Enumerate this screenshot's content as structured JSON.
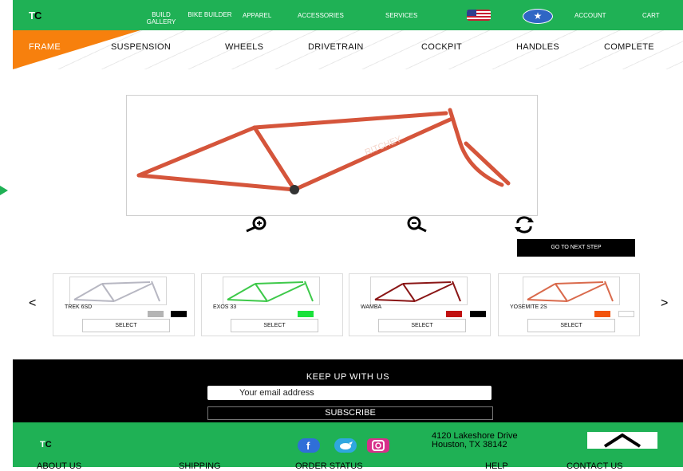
{
  "brand": {
    "logo_t": "T",
    "logo_c": "C"
  },
  "nav": {
    "build_gallery": "BUILD GALLERY",
    "bike_builder": "BIKE BUILDER",
    "apparel": "APPAREL",
    "accessories": "ACCESSORIES",
    "services": "SERVICES",
    "account": "ACCOUNT",
    "cart": "CART"
  },
  "steps": [
    "FRAME",
    "SUSPENSION",
    "WHEELS",
    "DRIVETRAIN",
    "COCKPIT",
    "HANDLES",
    "COMPLETE"
  ],
  "viewer": {
    "frame_text": "RITCHEY",
    "tools": [
      "zoom-in-icon",
      "zoom-out-icon",
      "rotate-icon"
    ]
  },
  "next_step": "GO TO NEXT STEP",
  "carousel": {
    "prev": "<",
    "next": ">",
    "items": [
      {
        "name": "TREK 6SD",
        "frame_color": "#b7b7c2",
        "swatches": [
          "#b4b4b4",
          "#000000"
        ],
        "select": "SELECT"
      },
      {
        "name": "EXOS 33",
        "frame_color": "#3ec94a",
        "swatches": [
          "#19e13a"
        ],
        "select": "SELECT"
      },
      {
        "name": "WAMBA",
        "frame_color": "#8a1616",
        "swatches": [
          "#c01010",
          "#000000"
        ],
        "select": "SELECT"
      },
      {
        "name": "YOSEMITE 2S",
        "frame_color": "#d96a4c",
        "swatches": [
          "#f2530b",
          "#ffffff"
        ],
        "select": "SELECT"
      }
    ]
  },
  "newsletter": {
    "title": "KEEP UP WITH US",
    "placeholder": "Your email address",
    "button": "SUBSCRIBE"
  },
  "footer": {
    "logo_t": "T",
    "logo_c": "C",
    "address_line1": "4120 Lakeshore Drive",
    "address_line2": "Houston, TX 38142",
    "links": [
      "ABOUT US",
      "SHIPPING",
      "ORDER STATUS",
      "HELP",
      "CONTACT US"
    ],
    "social": [
      "facebook-icon",
      "twitter-icon",
      "instagram-icon"
    ]
  },
  "colors": {
    "brand_green": "#1fb155",
    "accent_orange": "#f7800d",
    "frame_orange": "#d5553b"
  }
}
